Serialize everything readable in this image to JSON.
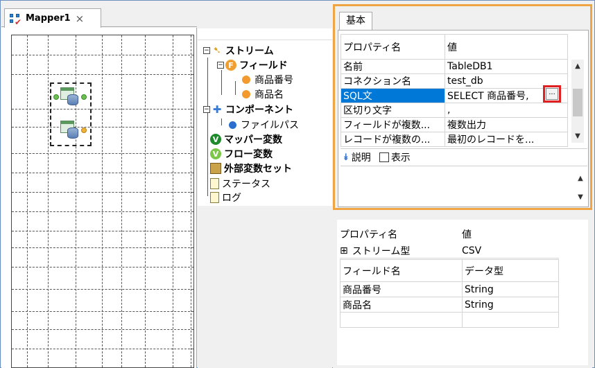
{
  "editor": {
    "tab_label": "Mapper1",
    "close_glyph": "×"
  },
  "tree": {
    "nodes": [
      {
        "label": "ストリーム",
        "icon": "stream-icon",
        "bold": true
      },
      {
        "label": "フィールド",
        "icon": "field-icon",
        "bold": true
      },
      {
        "label": "商品番号",
        "icon": "orange-ball-icon",
        "bold": false
      },
      {
        "label": "商品名",
        "icon": "orange-ball-icon",
        "bold": false
      },
      {
        "label": "コンポーネント",
        "icon": "puzzle-icon",
        "bold": true
      },
      {
        "label": "ファイルパス",
        "icon": "blue-ball-icon",
        "bold": false
      },
      {
        "label": "マッパー変数",
        "icon": "green-shield-icon",
        "bold": true
      },
      {
        "label": "フロー変数",
        "icon": "light-green-shield-icon",
        "bold": true
      },
      {
        "label": "外部変数セット",
        "icon": "chest-icon",
        "bold": true
      },
      {
        "label": "ステータス",
        "icon": "clipboard-icon",
        "bold": false
      },
      {
        "label": "ログ",
        "icon": "clipboard-icon",
        "bold": false
      }
    ]
  },
  "basic_panel": {
    "tab_label": "基本",
    "col_name": "プロパティ名",
    "col_value": "値",
    "rows": [
      {
        "name": "名前",
        "value": "TableDB1"
      },
      {
        "name": "コネクション名",
        "value": "test_db"
      },
      {
        "name": "SQL文",
        "value": "SELECT 商品番号,"
      },
      {
        "name": "区切り文字",
        "value": ","
      },
      {
        "name": "フィールドが複数...",
        "value": "複数出力"
      },
      {
        "name": "レコードが複数の...",
        "value": "最初のレコードを..."
      }
    ],
    "dots_label": "...",
    "description_label": "説明",
    "show_label": "表示"
  },
  "stream_panel": {
    "col_name": "プロパティ名",
    "col_value": "値",
    "stream_type_label": "ストリーム型",
    "stream_type_value": "CSV",
    "expand_glyph": "⊞",
    "field_col_name": "フィールド名",
    "field_col_type": "データ型",
    "fields": [
      {
        "name": "商品番号",
        "type": "String"
      },
      {
        "name": "商品名",
        "type": "String"
      }
    ]
  },
  "colors": {
    "selection": "#0078d7",
    "panel_highlight": "#f0a544",
    "button_highlight": "#e02020"
  }
}
